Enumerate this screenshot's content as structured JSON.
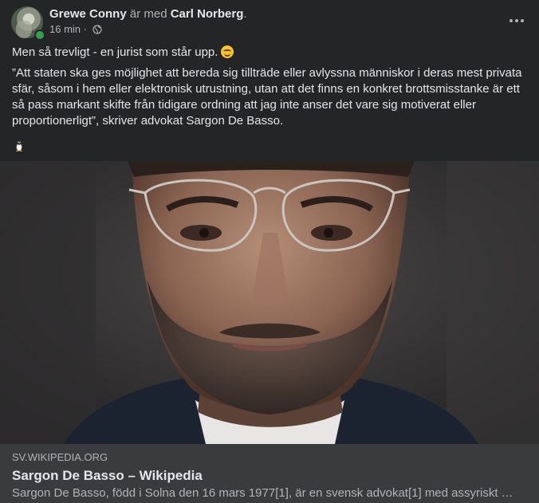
{
  "post": {
    "author": "Grewe Conny",
    "with_text": "är med",
    "tagged": "Carl Norberg",
    "tagged_suffix": ".",
    "time": "16 min",
    "separator": "·",
    "privacy_icon": "globe-icon",
    "more_icon": "more-options-icon",
    "text_line1": "Men så trevligt - en jurist som står upp.",
    "text_quote": "”Att staten ska ges möjlighet att bereda sig tillträde eller avlyssna människor i deras mest privata sfär, såsom i hem eller elektronisk utrustning, utan att det finns en konkret brottsmisstanke är ett så pass markant skifte från tidigare ordning att jag inte anser det vare sig motiverat eller proportionerligt”, skriver advokat Sargon De Basso.",
    "emoji_smile": "smiling-face-emoji",
    "emoji_penguin": "penguin-emoji"
  },
  "link": {
    "domain": "SV.WIKIPEDIA.ORG",
    "title": "Sargon De Basso – Wikipedia",
    "description": "Sargon De Basso, född i Solna den 16 mars 1977[1], är en svensk advokat[1] med assyriskt …"
  },
  "colors": {
    "background": "#242526",
    "link_box": "#3a3b3c",
    "primary_text": "#e4e6eb",
    "secondary_text": "#b0b3b8",
    "online": "#31a24c"
  }
}
